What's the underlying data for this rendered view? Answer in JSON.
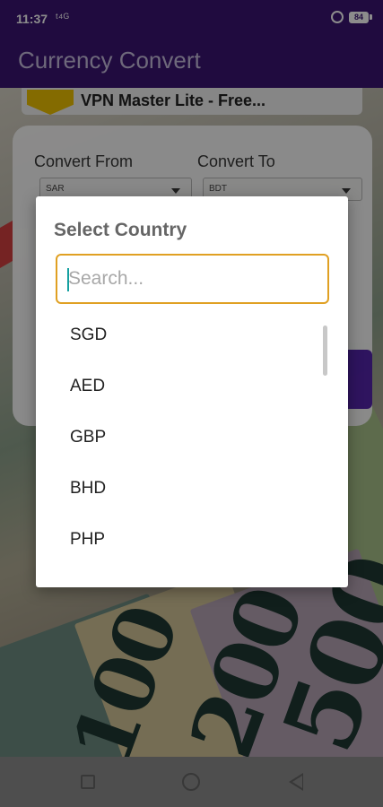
{
  "status_bar": {
    "time": "11:37",
    "signal": " ᵗᴳ",
    "battery": "84"
  },
  "app_bar": {
    "title": "Currency Convert"
  },
  "ad": {
    "title": "VPN Master Lite - Free..."
  },
  "converter": {
    "from_label": "Convert From",
    "to_label": "Convert To",
    "from_value": "SAR",
    "to_value": "BDT"
  },
  "background_notes": [
    "100",
    "200",
    "500"
  ],
  "dialog": {
    "title": "Select Country",
    "search_placeholder": "Search...",
    "items": [
      "SGD",
      "AED",
      "GBP",
      "BHD",
      "PHP"
    ]
  },
  "colors": {
    "app_bar": "#3b1573",
    "accent": "#e0a022",
    "button": "#5320b0"
  }
}
